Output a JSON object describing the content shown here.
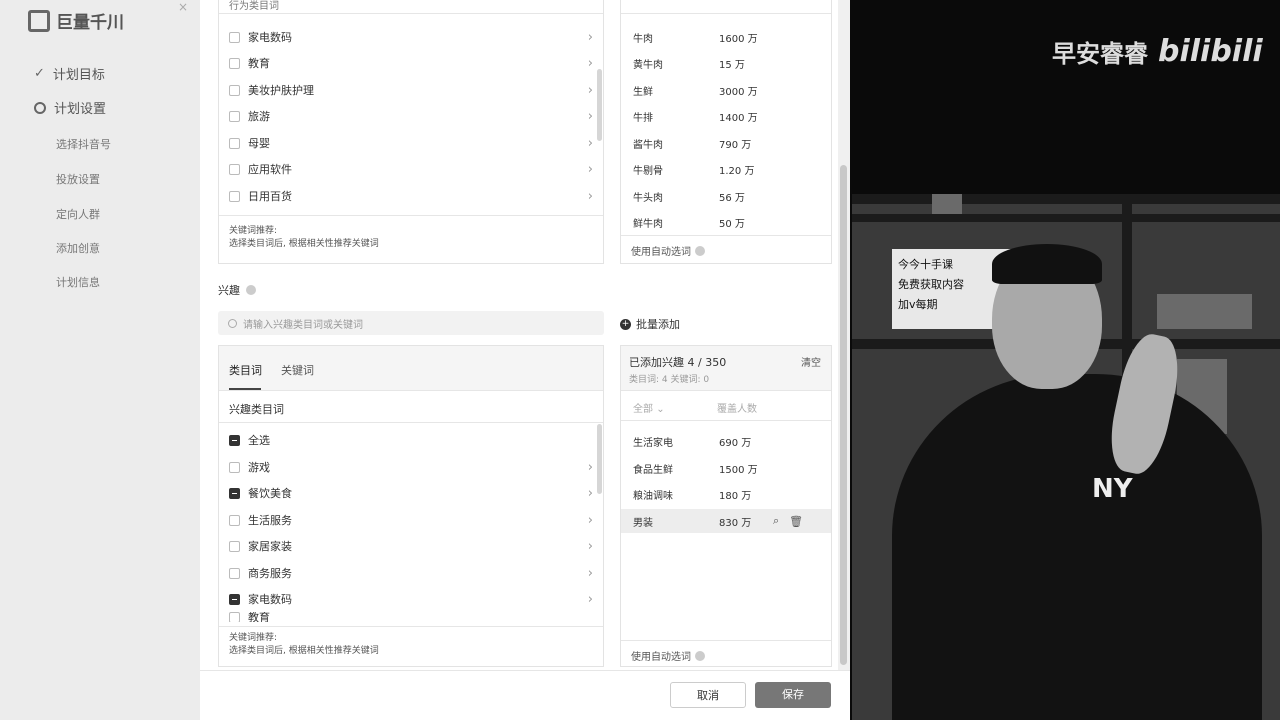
{
  "app": {
    "logo_text": "巨量千川",
    "close_glyph": "×",
    "sidebar": {
      "items": [
        {
          "label": "计划目标"
        },
        {
          "label": "计划设置"
        }
      ],
      "sub_items": [
        "选择抖音号",
        "投放设置",
        "定向人群",
        "添加创意",
        "计划信息"
      ]
    }
  },
  "top_section": {
    "header_partial": "行为类目词",
    "categories": [
      "家电数码",
      "教育",
      "美妆护肤护理",
      "旅游",
      "母婴",
      "应用软件",
      "日用百货"
    ],
    "hint_title": "关键词推荐:",
    "hint_body": "选择类目词后, 根据相关性推荐关键词",
    "selected": [
      {
        "name": "牛肉",
        "count": "1600 万"
      },
      {
        "name": "黄牛肉",
        "count": "15 万"
      },
      {
        "name": "生鲜",
        "count": "3000 万"
      },
      {
        "name": "牛排",
        "count": "1400 万"
      },
      {
        "name": "酱牛肉",
        "count": "790 万"
      },
      {
        "name": "牛剔骨",
        "count": "1.20 万"
      },
      {
        "name": "牛头肉",
        "count": "56 万"
      },
      {
        "name": "鲜牛肉",
        "count": "50 万"
      }
    ],
    "auto_select": "使用自动选词"
  },
  "interest": {
    "label": "兴趣",
    "search_placeholder": "请输入兴趣类目词或关键词",
    "batch_add": "批量添加",
    "tabs": [
      "类目词",
      "关键词"
    ],
    "sub_header": "兴趣类目词",
    "categories": [
      {
        "label": "全选",
        "checked": true,
        "arrow": false
      },
      {
        "label": "游戏",
        "checked": false,
        "arrow": true
      },
      {
        "label": "餐饮美食",
        "checked": true,
        "arrow": true
      },
      {
        "label": "生活服务",
        "checked": false,
        "arrow": true
      },
      {
        "label": "家居家装",
        "checked": false,
        "arrow": true
      },
      {
        "label": "商务服务",
        "checked": false,
        "arrow": true
      },
      {
        "label": "家电数码",
        "checked": true,
        "arrow": true
      },
      {
        "label": "教育",
        "checked": false,
        "arrow": false
      }
    ],
    "hint_title": "关键词推荐:",
    "hint_body": "选择类目词后, 根据相关性推荐关键词",
    "selected_title": "已添加兴趣 4 / 350",
    "clear": "清空",
    "selected_sub": "类目词: 4    关键词: 0",
    "col_all": "全部",
    "col_cover": "覆盖人数",
    "selected_rows": [
      {
        "name": "生活家电",
        "count": "690 万"
      },
      {
        "name": "食品生鲜",
        "count": "1500 万"
      },
      {
        "name": "粮油调味",
        "count": "180 万"
      },
      {
        "name": "男装",
        "count": "830 万"
      }
    ],
    "auto_select": "使用自动选词"
  },
  "footer": {
    "cancel": "取消",
    "save": "保存"
  },
  "video": {
    "brand": "早安睿睿",
    "bili": "bilibili",
    "poster_lines": [
      "今今十手课",
      "免费获取内容",
      "加v每期"
    ],
    "shirt_logo": "NY"
  }
}
